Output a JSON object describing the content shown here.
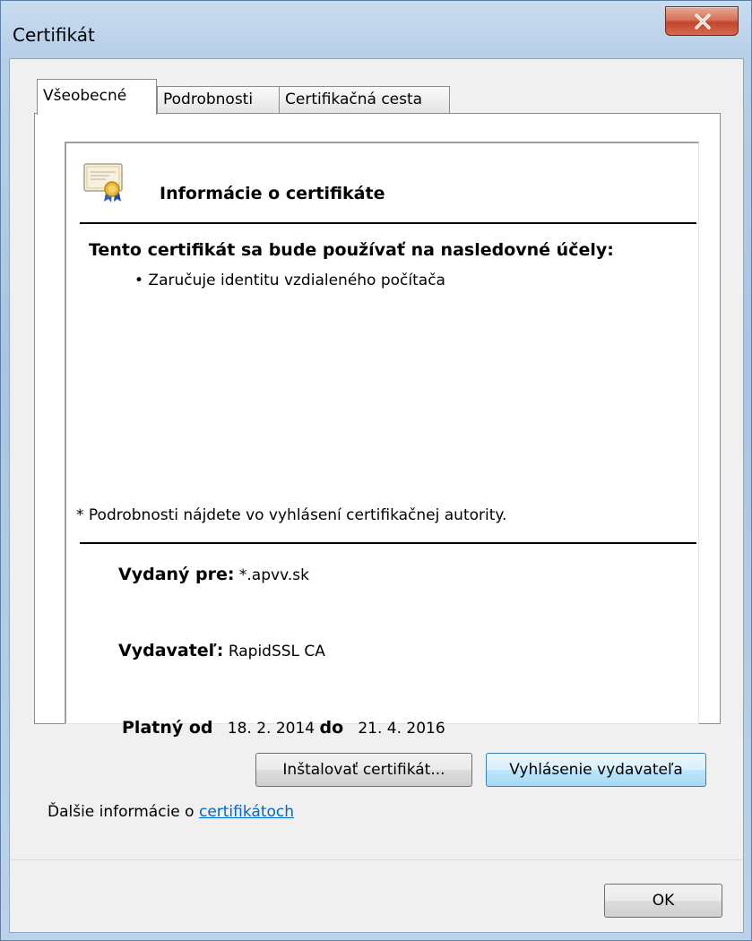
{
  "window": {
    "title": "Certifikát",
    "close_icon": "close-x-icon"
  },
  "tabs": [
    {
      "label": "Všeobecné",
      "active": true
    },
    {
      "label": "Podrobnosti",
      "active": false
    },
    {
      "label": "Certifikačná cesta",
      "active": false
    }
  ],
  "info": {
    "icon": "certificate-icon",
    "title": "Informácie o certifikáte",
    "purposes_heading": "Tento certifikát sa bude používať na nasledovné účely:",
    "purposes": [
      "• Zaručuje identitu vzdialeného počítača"
    ],
    "footnote": "* Podrobnosti nájdete vo vyhlásení certifikačnej autority.",
    "issued_to_label": "Vydaný pre:",
    "issued_to_value": "*.apvv.sk",
    "issuer_label": "Vydavateľ:",
    "issuer_value": "RapidSSL CA",
    "valid_from_label": "Platný od",
    "valid_from_value": "18. 2. 2014",
    "valid_to_label": "do",
    "valid_to_value": "21. 4. 2016"
  },
  "buttons": {
    "install": "Inštalovať certifikát...",
    "issuer_statement": "Vyhlásenie vydavateľa",
    "ok": "OK"
  },
  "more_info": {
    "prefix": "Ďalšie informácie o ",
    "link": "certifikátoch"
  }
}
